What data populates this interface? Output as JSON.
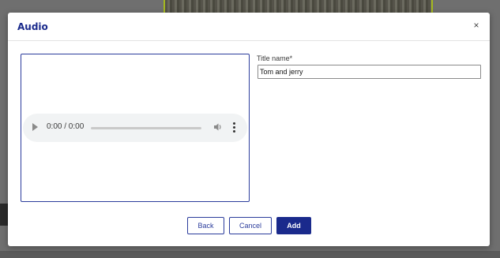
{
  "dialog": {
    "title": "Audio",
    "close_label": "×"
  },
  "player": {
    "time": "0:00 / 0:00",
    "icons": [
      "play-icon",
      "volume-icon",
      "more-vert-icon"
    ]
  },
  "form": {
    "title_label": "Title name*",
    "title_value": "Tom and jerry"
  },
  "buttons": {
    "back": "Back",
    "cancel": "Cancel",
    "add": "Add"
  },
  "colors": {
    "accent": "#1a2a8c",
    "border_accent": "#2b3c9c"
  }
}
